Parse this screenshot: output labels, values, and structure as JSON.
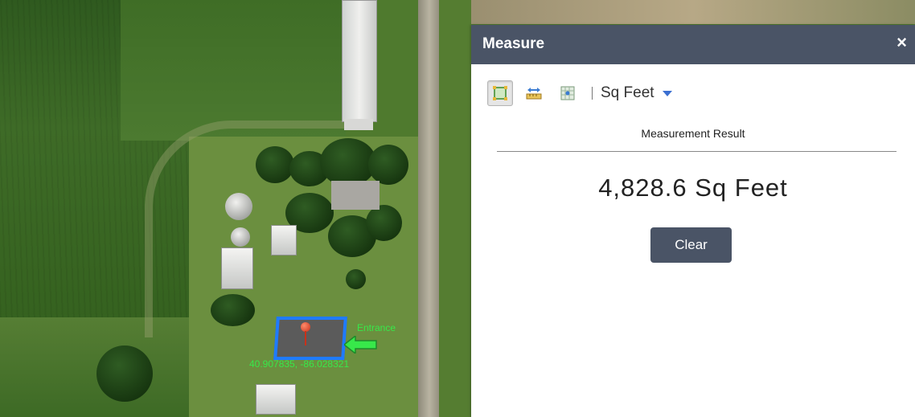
{
  "map": {
    "annotation_label": "Entrance",
    "coordinates": "40.907835, -86.028321",
    "measured_outline_color": "#1f7bff",
    "annotation_color": "#37e84a"
  },
  "panel": {
    "title": "Measure",
    "close_label": "×",
    "tools": [
      {
        "name": "area-tool-icon",
        "active": true
      },
      {
        "name": "distance-tool-icon",
        "active": false
      },
      {
        "name": "location-tool-icon",
        "active": false
      }
    ],
    "unit": "Sq Feet",
    "result_label": "Measurement Result",
    "result_value": "4,828.6 Sq Feet",
    "clear_label": "Clear",
    "header_color": "#4a5466"
  }
}
